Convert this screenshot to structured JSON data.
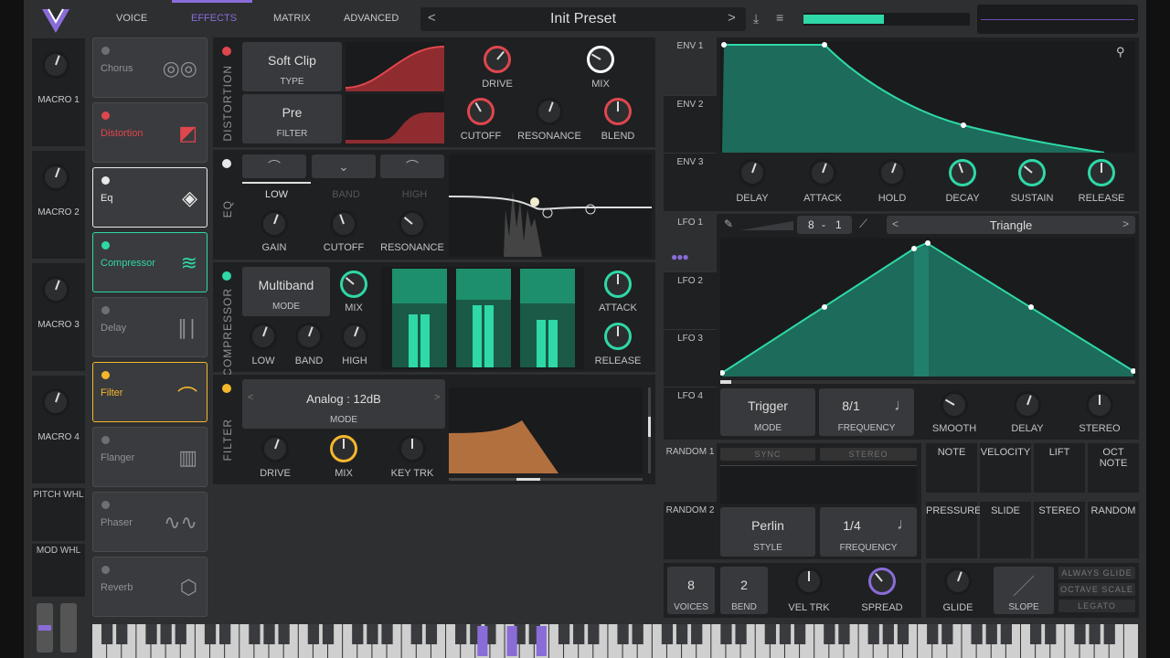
{
  "header": {
    "tabs": [
      "VOICE",
      "EFFECTS",
      "MATRIX",
      "ADVANCED"
    ],
    "preset_name": "Init Preset"
  },
  "macros": [
    "MACRO 1",
    "MACRO 2",
    "MACRO 3",
    "MACRO 4"
  ],
  "wheels": {
    "pitch": "PITCH WHL",
    "mod": "MOD WHL"
  },
  "effects_list": [
    {
      "name": "Chorus",
      "color": "#6d6f72",
      "active": false
    },
    {
      "name": "Distortion",
      "color": "#e0464d",
      "active": true
    },
    {
      "name": "Eq",
      "color": "#e8e8e8",
      "active": true
    },
    {
      "name": "Compressor",
      "color": "#2ed8a7",
      "active": true
    },
    {
      "name": "Delay",
      "color": "#6d6f72",
      "active": false
    },
    {
      "name": "Filter",
      "color": "#f5b72c",
      "active": true
    },
    {
      "name": "Flanger",
      "color": "#6d6f72",
      "active": false
    },
    {
      "name": "Phaser",
      "color": "#6d6f72",
      "active": false
    },
    {
      "name": "Reverb",
      "color": "#6d6f72",
      "active": false
    }
  ],
  "distortion": {
    "title": "DISTORTION",
    "type_value": "Soft Clip",
    "type_label": "TYPE",
    "filter_value": "Pre",
    "filter_label": "FILTER",
    "drive": "DRIVE",
    "mix": "MIX",
    "cutoff": "CUTOFF",
    "resonance": "RESONANCE",
    "blend": "BLEND"
  },
  "eq": {
    "title": "EQ",
    "bands": [
      "LOW",
      "BAND",
      "HIGH"
    ],
    "gain": "GAIN",
    "cutoff": "CUTOFF",
    "resonance": "RESONANCE"
  },
  "compressor": {
    "title": "COMPRESSOR",
    "mode_value": "Multiband",
    "mode_label": "MODE",
    "mix": "MIX",
    "attack": "ATTACK",
    "release": "RELEASE",
    "low": "LOW",
    "band": "BAND",
    "high": "HIGH"
  },
  "filter": {
    "title": "FILTER",
    "model": "Analog : 12dB",
    "mode_label": "MODE",
    "drive": "DRIVE",
    "mix": "MIX",
    "key_trk": "KEY TRK"
  },
  "env": {
    "tabs": [
      "ENV 1",
      "ENV 2",
      "ENV 3"
    ],
    "knobs": [
      "DELAY",
      "ATTACK",
      "HOLD",
      "DECAY",
      "SUSTAIN",
      "RELEASE"
    ]
  },
  "lfo": {
    "tabs": [
      "LFO 1",
      "LFO 2",
      "LFO 3",
      "LFO 4"
    ],
    "rate_num": "8",
    "rate_sep": "-",
    "rate_den": "1",
    "shape": "Triangle",
    "mode_value": "Trigger",
    "mode_label": "MODE",
    "freq_value": "8/1",
    "freq_label": "FREQUENCY",
    "smooth": "SMOOTH",
    "delay": "DELAY",
    "stereo": "STEREO"
  },
  "random": {
    "tabs": [
      "RANDOM 1",
      "RANDOM 2"
    ],
    "sync": "SYNC",
    "stereo": "STEREO",
    "style_value": "Perlin",
    "style_label": "STYLE",
    "freq_value": "1/4",
    "freq_label": "FREQUENCY"
  },
  "mod_sources": [
    "NOTE",
    "VELOCITY",
    "LIFT",
    "OCT NOTE",
    "PRESSURE",
    "SLIDE",
    "STEREO",
    "RANDOM"
  ],
  "voice": {
    "voices_value": "8",
    "voices_label": "VOICES",
    "bend_value": "2",
    "bend_label": "BEND",
    "vel_trk": "VEL TRK",
    "spread": "SPREAD",
    "glide": "GLIDE",
    "slope": "SLOPE",
    "always_glide": "ALWAYS GLIDE",
    "octave_scale": "OCTAVE SCALE",
    "legato": "LEGATO"
  },
  "colors": {
    "accent": "#2ed8a7",
    "distortion": "#e0464d",
    "filter": "#f5b72c",
    "purple": "#8a6cd9"
  }
}
